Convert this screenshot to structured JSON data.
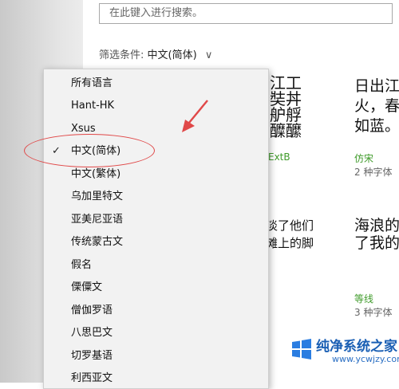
{
  "search": {
    "placeholder": "在此键入进行搜索。"
  },
  "filter": {
    "label": "筛选条件:",
    "value": "中文(简体)",
    "chevron": "∨"
  },
  "samples": [
    "工江工\n乒奘丼\n舺舮艀\n醽醾醿",
    "日出江\n火，春\n如蓝。",
    "少淡了他们\n少滩上的脚",
    "海浪的\n了我的"
  ],
  "font_cards": [
    {
      "name": "ExtB",
      "count": ""
    },
    {
      "name": "仿宋",
      "count": "2 种字体"
    },
    {
      "name": "等线",
      "count": "3 种字体"
    }
  ],
  "dropdown": {
    "items": [
      {
        "label": "所有语言",
        "checked": false
      },
      {
        "label": "Hant-HK",
        "checked": false
      },
      {
        "label": "Xsus",
        "checked": false
      },
      {
        "label": "中文(简体)",
        "checked": true
      },
      {
        "label": "中文(繁体)",
        "checked": false
      },
      {
        "label": "乌加里特文",
        "checked": false
      },
      {
        "label": "亚美尼亚语",
        "checked": false
      },
      {
        "label": "传统蒙古文",
        "checked": false
      },
      {
        "label": "假名",
        "checked": false
      },
      {
        "label": "傈僳文",
        "checked": false
      },
      {
        "label": "僧伽罗语",
        "checked": false
      },
      {
        "label": "八思巴文",
        "checked": false
      },
      {
        "label": "切罗基语",
        "checked": false
      },
      {
        "label": "利西亚文",
        "checked": false
      }
    ],
    "check_glyph": "✓"
  },
  "annotation": {
    "color": "#e04848"
  },
  "watermark": {
    "title": "纯净系统之家",
    "url": "www.ycwjzy.com"
  }
}
